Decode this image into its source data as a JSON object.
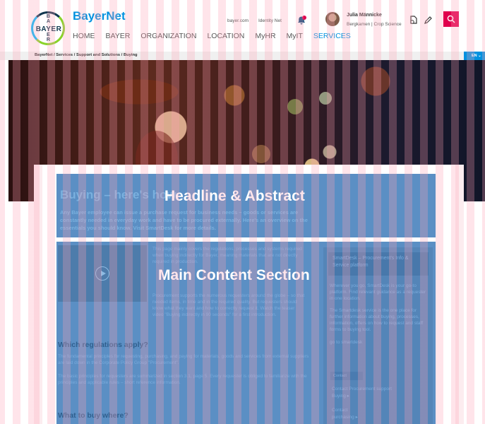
{
  "header": {
    "logo_text": "BAYER",
    "brand": "BayerNet",
    "nav": [
      "HOME",
      "BAYER",
      "ORGANIZATION",
      "LOCATION",
      "MyHR",
      "MyIT",
      "SERVICES"
    ],
    "active_nav": "SERVICES",
    "top_links": [
      "bayer.com",
      "Identity Net"
    ],
    "user_name": "Julia Männicke",
    "user_location": "Bergkamen | Crop Science",
    "icons": [
      "notification-bell-icon",
      "document-sync-icon",
      "pencil-icon",
      "search-icon"
    ]
  },
  "breadcrumb": "BayerNet  / Services / Support and Solutions / Buying",
  "language": "EN",
  "headline": {
    "title": "Buying – here's how",
    "abstract": "Any Bayer employee can issue a purchase request for business needs – goods or services are constantly needed in everyday work and have to be procured externally. Here's an overview on the essentials you should know. Visit SmartDesk for more details.",
    "overlay_label": "Headline & Abstract"
  },
  "main": {
    "overlay_label": "Main Content Section",
    "intro_text": "This page mainly covers the regulations, processes and systems required when buying indirectly for Bayer, meaning materials that are not directly required in production.",
    "procurement_text": "Procurement supports the numerous requesters around the globe – so that needed items, in time and in the required quality. But requesters should know what they want and how to correctly request it. Watch the teaser video \"Buying indirectly in 90 seconds\" for a first introduction.",
    "section_1_heading": "Which regulations apply?",
    "section_1_text": "The fundamental principles for requesting, purchasing, and paying for materials, goods and services from external suppliers are laid down in the Corporate Policy Group \"Procurement\".",
    "section_1_text_2": "The basic principles for requesters are summarized in section 3.1, page 5. Every requester is obliged to familiarize with the principles and applicable rules – short reference information.",
    "section_2_heading": "What to buy where?",
    "sidebar": {
      "title": "SmartDesk – Procurement's Info & Service platform",
      "text_1": "Wherever you go, SmartDesk is your go-to platform. Find relevant guidance as a requester in one location.",
      "text_2": "The Smartdesk service is the one place for further information about buying, processes, information, offers on how to request and staff forms to buying tool.",
      "link": "go to smartdesk",
      "pill": "Contact",
      "contact_1": "Contact Procurement support",
      "contact_1_sub": "Buying ▸",
      "contact_2": "Contact",
      "contact_2_sub": "purchasing ▸"
    }
  }
}
